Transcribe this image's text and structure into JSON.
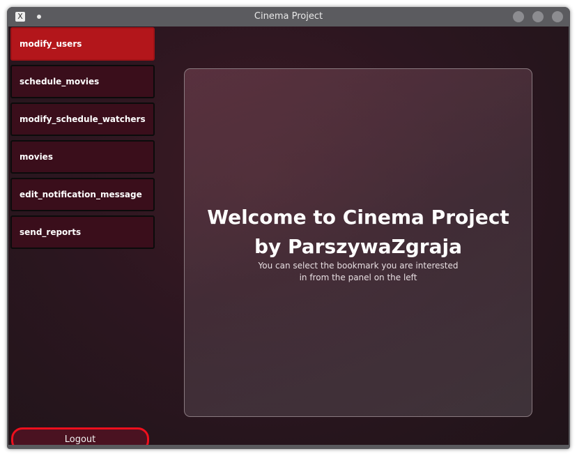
{
  "window": {
    "title": "Cinema Project",
    "app_icon": "x-app-icon"
  },
  "sidebar": {
    "items": [
      {
        "label": "modify_users",
        "active": true
      },
      {
        "label": "schedule_movies",
        "active": false
      },
      {
        "label": "modify_schedule_watchers",
        "active": false
      },
      {
        "label": "movies",
        "active": false
      },
      {
        "label": "edit_notification_message",
        "active": false
      },
      {
        "label": "send_reports",
        "active": false
      }
    ],
    "logout_label": "Logout"
  },
  "main": {
    "welcome_line1": "Welcome to Cinema Project",
    "welcome_line2": "by ParszywaZgraja",
    "hint_line1": "You can select the bookmark you are interested",
    "hint_line2": "in from the panel on the left"
  },
  "colors": {
    "active_item": "#b3161b",
    "item_bg": "#3a0e1b",
    "logout_border": "#ee0f1d",
    "background": "#2c1620"
  }
}
